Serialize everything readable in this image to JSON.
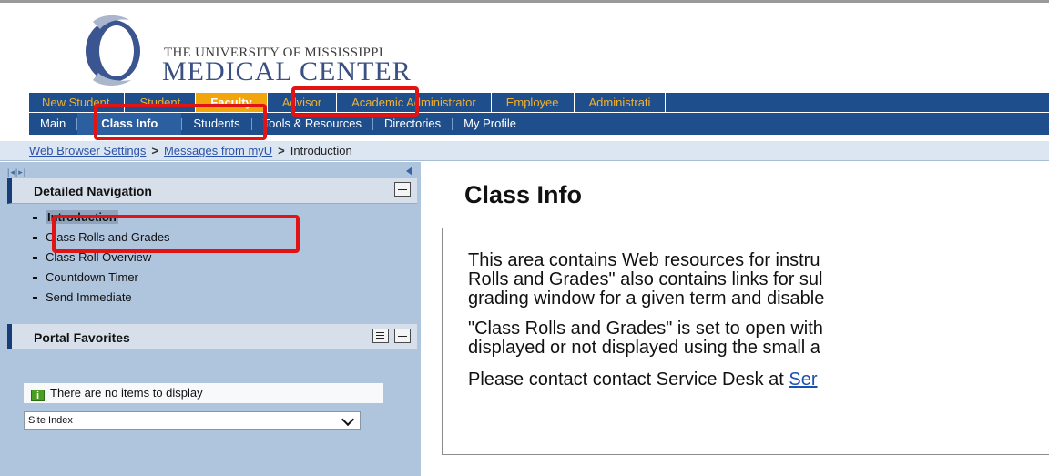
{
  "logo": {
    "line1": "THE UNIVERSITY OF MISSISSIPPI",
    "line2": "MEDICAL CENTER"
  },
  "role_tabs": [
    {
      "label": "New Student"
    },
    {
      "label": "Student"
    },
    {
      "label": "Faculty"
    },
    {
      "label": "Advisor"
    },
    {
      "label": "Academic Administrator"
    },
    {
      "label": "Employee"
    },
    {
      "label": "Administrati"
    }
  ],
  "sub_tabs": [
    {
      "label": "Main"
    },
    {
      "label": "Class Info"
    },
    {
      "label": "Students"
    },
    {
      "label": "Tools & Resources"
    },
    {
      "label": "Directories"
    },
    {
      "label": "My Profile"
    }
  ],
  "breadcrumb": {
    "link1": "Web Browser Settings",
    "link2": "Messages from myU",
    "separator": ">",
    "current": "Introduction"
  },
  "sidebar": {
    "pager": "|◂|▸|",
    "detailed_nav_title": "Detailed Navigation",
    "nav_items": [
      {
        "label": "Introduction"
      },
      {
        "label": "Class Rolls and Grades"
      },
      {
        "label": "Class Roll Overview"
      },
      {
        "label": "Countdown Timer"
      },
      {
        "label": "Send Immediate"
      }
    ],
    "favorites_title": "Portal Favorites",
    "favorites_empty": "There are no items to display",
    "info_glyph": "i",
    "site_index": "Site Index"
  },
  "main": {
    "title": "Class Info",
    "para1_line1": "This area contains Web resources for instru",
    "para1_line2": "Rolls and Grades\" also contains links for sul",
    "para1_line3": "grading window for a given term and disable",
    "para2_line1": "\"Class Rolls and Grades\" is set to open with",
    "para2_line2": "displayed or not displayed using the small a",
    "para3_text": "Please contact contact Service Desk at ",
    "para3_link": "Ser"
  },
  "colors": {
    "nav_blue": "#1f4e8c",
    "active_tab_orange": "#f2a60c",
    "sidebar_blue": "#afc4dd",
    "highlight_red": "#e01414"
  }
}
